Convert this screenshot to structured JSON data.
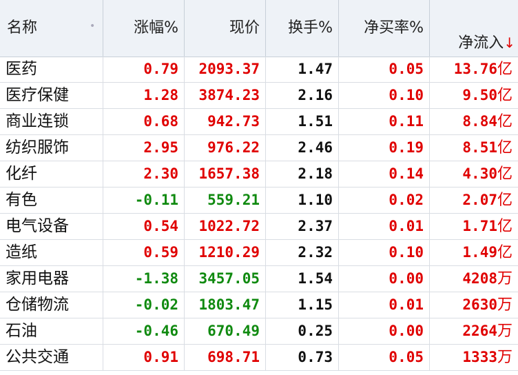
{
  "headers": {
    "name": "名称",
    "change": "涨幅%",
    "price": "现价",
    "turnover": "换手%",
    "net_buy": "净买率%",
    "net_inflow": "净流入",
    "sort_arrow": "↓"
  },
  "rows": [
    {
      "name": "医药",
      "change": "0.79",
      "price": "2093.37",
      "turnover": "1.47",
      "net_buy": "0.05",
      "inflow": "13.76",
      "unit": "亿",
      "dir": "up"
    },
    {
      "name": "医疗保健",
      "change": "1.28",
      "price": "3874.23",
      "turnover": "2.16",
      "net_buy": "0.10",
      "inflow": "9.50",
      "unit": "亿",
      "dir": "up"
    },
    {
      "name": "商业连锁",
      "change": "0.68",
      "price": "942.73",
      "turnover": "1.51",
      "net_buy": "0.11",
      "inflow": "8.84",
      "unit": "亿",
      "dir": "up"
    },
    {
      "name": "纺织服饰",
      "change": "2.95",
      "price": "976.22",
      "turnover": "2.46",
      "net_buy": "0.19",
      "inflow": "8.51",
      "unit": "亿",
      "dir": "up"
    },
    {
      "name": "化纤",
      "change": "2.30",
      "price": "1657.38",
      "turnover": "2.18",
      "net_buy": "0.14",
      "inflow": "4.30",
      "unit": "亿",
      "dir": "up"
    },
    {
      "name": "有色",
      "change": "-0.11",
      "price": "559.21",
      "turnover": "1.10",
      "net_buy": "0.02",
      "inflow": "2.07",
      "unit": "亿",
      "dir": "down"
    },
    {
      "name": "电气设备",
      "change": "0.54",
      "price": "1022.72",
      "turnover": "2.37",
      "net_buy": "0.01",
      "inflow": "1.71",
      "unit": "亿",
      "dir": "up"
    },
    {
      "name": "造纸",
      "change": "0.59",
      "price": "1210.29",
      "turnover": "2.32",
      "net_buy": "0.10",
      "inflow": "1.49",
      "unit": "亿",
      "dir": "up"
    },
    {
      "name": "家用电器",
      "change": "-1.38",
      "price": "3457.05",
      "turnover": "1.54",
      "net_buy": "0.00",
      "inflow": "4208",
      "unit": "万",
      "dir": "down"
    },
    {
      "name": "仓储物流",
      "change": "-0.02",
      "price": "1803.47",
      "turnover": "1.15",
      "net_buy": "0.01",
      "inflow": "2630",
      "unit": "万",
      "dir": "down"
    },
    {
      "name": "石油",
      "change": "-0.46",
      "price": "670.49",
      "turnover": "0.25",
      "net_buy": "0.00",
      "inflow": "2264",
      "unit": "万",
      "dir": "down"
    },
    {
      "name": "公共交通",
      "change": "0.91",
      "price": "698.71",
      "turnover": "0.73",
      "net_buy": "0.05",
      "inflow": "1333",
      "unit": "万",
      "dir": "up"
    }
  ],
  "colors": {
    "up": "#e00000",
    "down": "#108a10",
    "neutral": "#111111",
    "header_bg": "#eef2f7"
  }
}
